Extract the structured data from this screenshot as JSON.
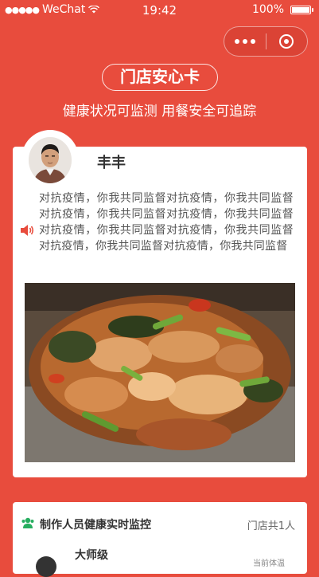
{
  "status_bar": {
    "carrier": "WeChat",
    "time": "19:42",
    "battery": "100%"
  },
  "header": {
    "title": "门店安心卡",
    "subtitle": "健康状况可监测 用餐安全可追踪"
  },
  "profile": {
    "name": "丰丰",
    "description": "对抗疫情，你我共同监督对抗疫情，你我共同监督对抗疫情，你我共同监督对抗疫情，你我共同监督对抗疫情，你我共同监督对抗疫情，你我共同监督对抗疫情，你我共同监督对抗疫情，你我共同监督"
  },
  "staff_section": {
    "title": "制作人员健康实时监控",
    "count": "门店共1人",
    "members": [
      {
        "name": "大师级",
        "temp_label": "当前体温"
      }
    ]
  },
  "colors": {
    "theme_red": "#e84c3d",
    "card_white": "#ffffff",
    "staff_icon_green": "#27ae60"
  }
}
